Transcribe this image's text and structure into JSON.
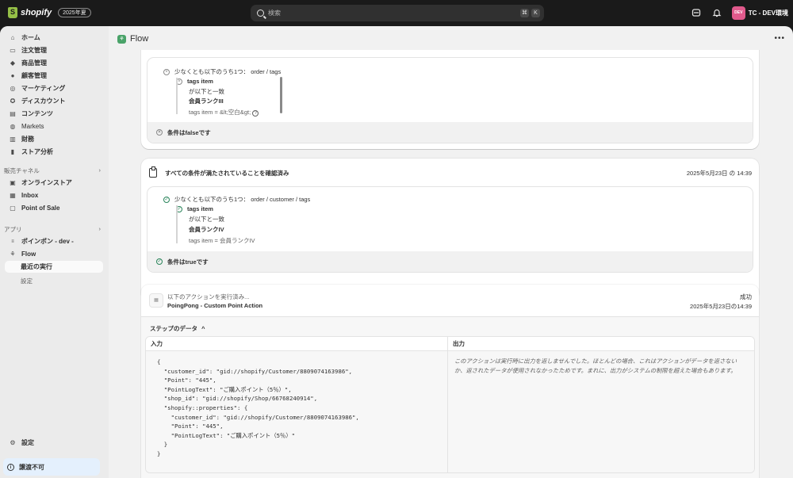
{
  "topbar": {
    "brand": "shopify",
    "edition_badge": "2025年夏",
    "search_placeholder": "検索",
    "shortcut_keys": [
      "⌘",
      "K"
    ],
    "store_avatar": "DEV",
    "store_name": "TC - DEV環境"
  },
  "sidebar": {
    "main_items": [
      {
        "label": "ホーム",
        "icon": "home-icon"
      },
      {
        "label": "注文管理",
        "icon": "inbox-icon"
      },
      {
        "label": "商品管理",
        "icon": "tag-icon"
      },
      {
        "label": "顧客管理",
        "icon": "person-icon"
      },
      {
        "label": "マーケティング",
        "icon": "target-icon"
      },
      {
        "label": "ディスカウント",
        "icon": "discount-icon"
      },
      {
        "label": "コンテンツ",
        "icon": "content-icon"
      },
      {
        "label": "Markets",
        "icon": "globe-icon"
      },
      {
        "label": "財務",
        "icon": "bank-icon"
      },
      {
        "label": "ストア分析",
        "icon": "chart-bar-icon"
      }
    ],
    "sales_channels_title": "販売チャネル",
    "channels": [
      {
        "label": "オンラインストア",
        "icon": "store-icon"
      },
      {
        "label": "Inbox",
        "icon": "chat-icon"
      },
      {
        "label": "Point of Sale",
        "icon": "pos-icon"
      }
    ],
    "apps_title": "アプリ",
    "apps": [
      {
        "label": "ポインポン - dev -",
        "icon": "app-icon"
      },
      {
        "label": "Flow",
        "icon": "flow-icon"
      }
    ],
    "flow_subitems": [
      "最近の実行",
      "設定"
    ],
    "settings_label": "設定",
    "unsubscribed_label": "譲渡不可"
  },
  "page": {
    "title": "Flow",
    "more_label": "•••"
  },
  "condition_false": {
    "heading": "少なくとも以下のうち1つ： order / tags",
    "item_title": "tags item",
    "item_op": "が以下と一致",
    "item_value": "会員ランクIII",
    "item_expr": "tags item = &lt;空白&gt;",
    "result": "条件はfalseです"
  },
  "condition_true": {
    "card_title": "すべての条件が満たされていることを確認済み",
    "timestamp": "2025年5月23日 の 14:39",
    "heading": "少なくとも以下のうち1つ： order / customer / tags",
    "item_title": "tags item",
    "item_op": "が以下と一致",
    "item_value": "会員ランクIV",
    "item_expr": "tags item = 会員ランクIV",
    "result": "条件はtrueです"
  },
  "action": {
    "subtitle": "以下のアクションを実行済み...",
    "name": "PoingPong - Custom Point Action",
    "status": "成功",
    "timestamp": "2025年5月23日の14:39",
    "step_data_label": "ステップのデータ",
    "input_label": "入力",
    "output_label": "出力",
    "input_code": "{\n  \"customer_id\": \"gid://shopify/Customer/8809074163986\",\n  \"Point\": \"445\",\n  \"PointLogText\": \"ご購入ポイント（5％）\",\n  \"shop_id\": \"gid://shopify/Shop/66768240914\",\n  \"shopify::properties\": {\n    \"customer_id\": \"gid://shopify/Customer/8809074163986\",\n    \"Point\": \"445\",\n    \"PointLogText\": \"ご購入ポイント（5％）\"\n  }\n}",
    "output_note": "このアクションは実行時に出力を返しませんでした。ほとんどの場合、これはアクションがデータを返さないか、返されたデータが使用されなかったためです。まれに、出力がシステムの制限を超えた場合もあります。"
  }
}
